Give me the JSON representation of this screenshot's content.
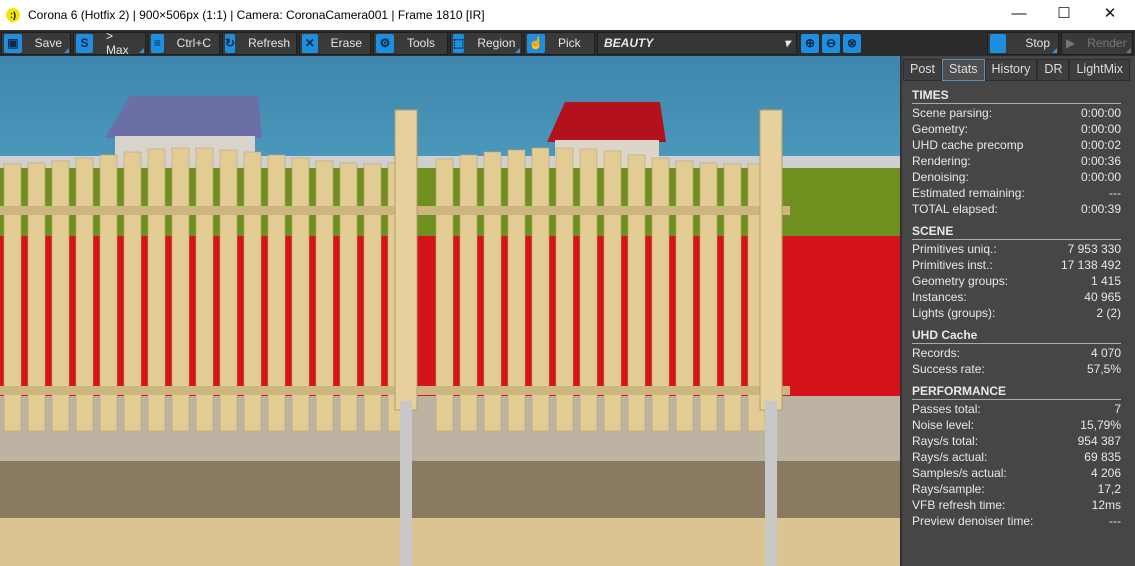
{
  "window": {
    "title": "Corona 6 (Hotfix 2) | 900×506px (1:1) | Camera: CoronaCamera001 | Frame 1810 [IR]",
    "logo": ":)",
    "minimize": "—",
    "maximize": "☐",
    "close": "✕"
  },
  "toolbar": {
    "buttons": [
      {
        "label": "Save",
        "icon": "floppy-icon",
        "glyph": "▣"
      },
      {
        "label": "> Max",
        "icon": "max-icon",
        "glyph": "S"
      },
      {
        "label": "Ctrl+C",
        "icon": "copy-icon",
        "glyph": "≡"
      },
      {
        "label": "Refresh",
        "icon": "refresh-icon",
        "glyph": "↻"
      },
      {
        "label": "Erase",
        "icon": "erase-icon",
        "glyph": "✕"
      },
      {
        "label": "Tools",
        "icon": "gear-icon",
        "glyph": "⚙"
      },
      {
        "label": "Region",
        "icon": "region-icon",
        "glyph": "⬚"
      },
      {
        "label": "Pick",
        "icon": "hand-icon",
        "glyph": "☝"
      }
    ],
    "render_pass": "BEAUTY",
    "stop": "Stop",
    "render": "Render",
    "accent": "#1e8fe0"
  },
  "panel": {
    "tabs": [
      "Post",
      "Stats",
      "History",
      "DR",
      "LightMix"
    ],
    "active_tab": "Stats",
    "sections": [
      {
        "title": "TIMES",
        "rows": [
          [
            "Scene parsing:",
            "0:00:00"
          ],
          [
            "Geometry:",
            "0:00:00"
          ],
          [
            "UHD cache precomp",
            "0:00:02"
          ],
          [
            "Rendering:",
            "0:00:36"
          ],
          [
            "Denoising:",
            "0:00:00"
          ],
          [
            "Estimated remaining:",
            "---"
          ],
          [
            "TOTAL elapsed:",
            "0:00:39"
          ]
        ]
      },
      {
        "title": "SCENE",
        "rows": [
          [
            "Primitives uniq.:",
            "7 953 330"
          ],
          [
            "Primitives inst.:",
            "17 138 492"
          ],
          [
            "Geometry groups:",
            "1 415"
          ],
          [
            "Instances:",
            "40 965"
          ],
          [
            "Lights (groups):",
            "2 (2)"
          ]
        ]
      },
      {
        "title": "UHD Cache",
        "rows": [
          [
            "Records:",
            "4 070"
          ],
          [
            "Success rate:",
            "57,5%"
          ]
        ]
      },
      {
        "title": "PERFORMANCE",
        "rows": [
          [
            "Passes total:",
            "7"
          ],
          [
            "Noise level:",
            "15,79%"
          ],
          [
            "Rays/s total:",
            "954 387"
          ],
          [
            "Rays/s actual:",
            "69 835"
          ],
          [
            "Samples/s actual:",
            "4 206"
          ],
          [
            "Rays/sample:",
            "17,2"
          ],
          [
            "VFB refresh time:",
            "12ms"
          ],
          [
            "Preview denoiser time:",
            "---"
          ]
        ]
      }
    ]
  }
}
